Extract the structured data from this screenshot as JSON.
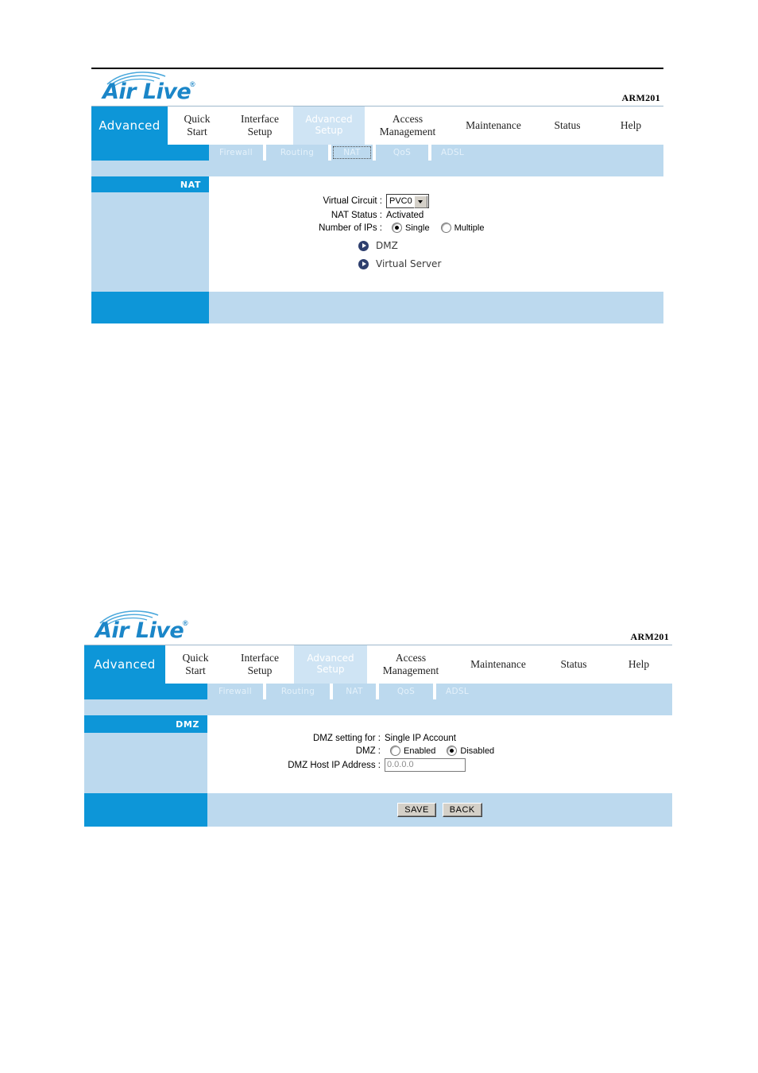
{
  "colors": {
    "primary_blue": "#0d96d8",
    "light_blue": "#bcd9ee",
    "active_tab_blue": "#cfe4f4",
    "bullet_navy": "#2e3f6e"
  },
  "brand": {
    "logo_text": "Air Live",
    "registered_mark": "®",
    "model": "ARM201"
  },
  "nav": {
    "section_label": "Advanced",
    "tabs": [
      {
        "label": "Quick\nStart",
        "active": false
      },
      {
        "label": "Interface\nSetup",
        "active": false
      },
      {
        "label": "Advanced\nSetup",
        "active": true
      },
      {
        "label": "Access\nManagement",
        "active": false
      },
      {
        "label": "Maintenance",
        "active": false
      },
      {
        "label": "Status",
        "active": false
      },
      {
        "label": "Help",
        "active": false
      }
    ],
    "subtabs": [
      {
        "label": "Firewall"
      },
      {
        "label": "Routing"
      },
      {
        "label": "NAT"
      },
      {
        "label": "QoS"
      },
      {
        "label": "ADSL"
      }
    ]
  },
  "panel_nat": {
    "side_title": "NAT",
    "fields": {
      "virtual_circuit_label": "Virtual Circuit :",
      "virtual_circuit_value": "PVC0",
      "virtual_circuit_options": [
        "PVC0"
      ],
      "nat_status_label": "NAT Status :",
      "nat_status_value": "Activated",
      "number_of_ips_label": "Number of IPs :",
      "ip_option_single": "Single",
      "ip_option_multiple": "Multiple",
      "ip_selected": "Single"
    },
    "links": [
      {
        "label": "DMZ"
      },
      {
        "label": "Virtual Server"
      }
    ]
  },
  "panel_dmz": {
    "side_title": "DMZ",
    "fields": {
      "dmz_setting_for_label": "DMZ setting for :",
      "dmz_setting_for_value": "Single IP Account",
      "dmz_label": "DMZ :",
      "dmz_option_enabled": "Enabled",
      "dmz_option_disabled": "Disabled",
      "dmz_selected": "Disabled",
      "host_ip_label": "DMZ Host IP Address :",
      "host_ip_value": "0.0.0.0"
    },
    "buttons": {
      "save": "SAVE",
      "back": "BACK"
    }
  }
}
